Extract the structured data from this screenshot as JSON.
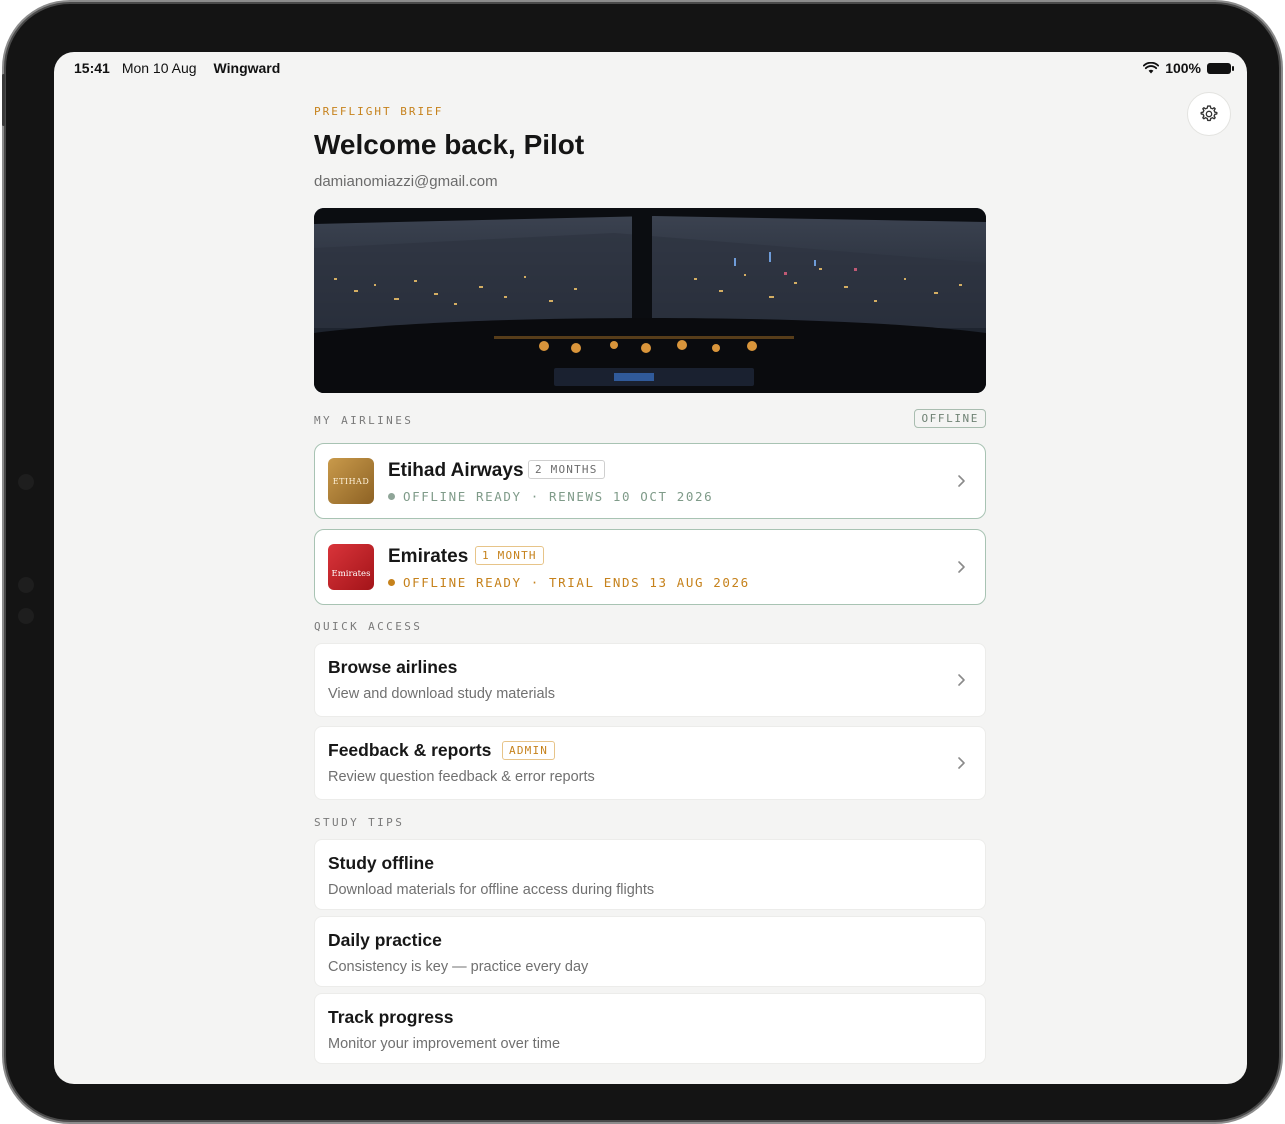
{
  "status_bar": {
    "time": "15:41",
    "date": "Mon 10 Aug",
    "app_name": "Wingward",
    "battery": "100%"
  },
  "header": {
    "eyebrow": "PREFLIGHT BRIEF",
    "title": "Welcome back, Pilot",
    "email": "damianomiazzi@gmail.com"
  },
  "my_airlines": {
    "label": "MY AIRLINES",
    "status_pill": "OFFLINE",
    "items": [
      {
        "name": "Etihad Airways",
        "badge": "2 MONTHS",
        "status": "OFFLINE READY · RENEWS 10 OCT 2026",
        "logo_text": "ETIHAD",
        "status_color": "#7f9b89",
        "dot_color": "#8fa598"
      },
      {
        "name": "Emirates",
        "badge": "1 MONTH",
        "status": "OFFLINE READY · TRIAL ENDS 13 AUG 2026",
        "logo_text": "Emirates",
        "status_color": "#c6821c",
        "dot_color": "#c6821c"
      }
    ]
  },
  "quick_access": {
    "label": "QUICK ACCESS",
    "items": [
      {
        "title": "Browse airlines",
        "subtitle": "View and download study materials"
      },
      {
        "title": "Feedback & reports",
        "badge": "ADMIN",
        "subtitle": "Review question feedback & error reports"
      }
    ]
  },
  "study_tips": {
    "label": "STUDY TIPS",
    "items": [
      {
        "title": "Study offline",
        "subtitle": "Download materials for offline access during flights"
      },
      {
        "title": "Daily practice",
        "subtitle": "Consistency is key — practice every day"
      },
      {
        "title": "Track progress",
        "subtitle": "Monitor your improvement over time"
      }
    ]
  },
  "colors": {
    "accent": "#c6821c",
    "offline_green": "#7f9b89",
    "background": "#f4f4f3"
  },
  "icons": [
    "gear-icon",
    "wifi-icon",
    "battery-icon",
    "chevron-right-icon"
  ]
}
